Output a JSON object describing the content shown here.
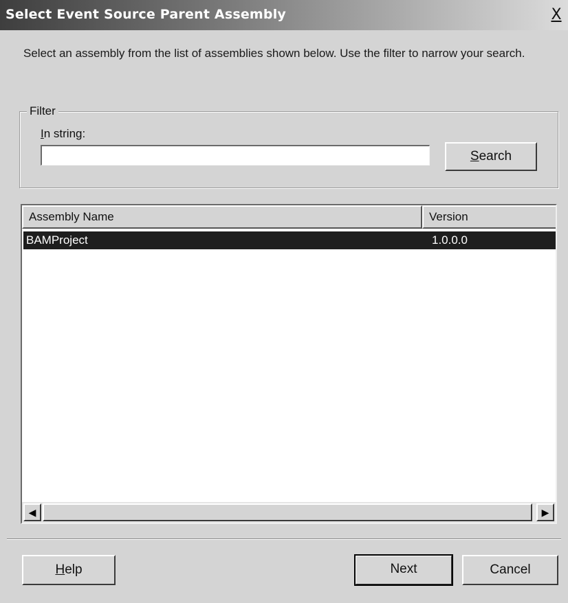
{
  "window": {
    "title": "Select Event Source Parent Assembly",
    "close_label": "X"
  },
  "instructions": "Select an assembly from the list of assemblies shown below.  Use the filter to narrow your search.",
  "filter": {
    "legend": "Filter",
    "instring_label_accel": "I",
    "instring_label_rest": "n string:",
    "input_value": "",
    "search_label_accel": "S",
    "search_label_rest": "earch"
  },
  "list": {
    "columns": [
      "Assembly Name",
      "Version"
    ],
    "rows": [
      {
        "name": "BAMProject",
        "version": "1.0.0.0",
        "selected": true
      }
    ]
  },
  "scrollbar": {
    "left_arrow": "◀",
    "right_arrow": "▶"
  },
  "buttons": {
    "help_accel": "H",
    "help_rest": "elp",
    "next": "Next",
    "cancel": "Cancel"
  }
}
